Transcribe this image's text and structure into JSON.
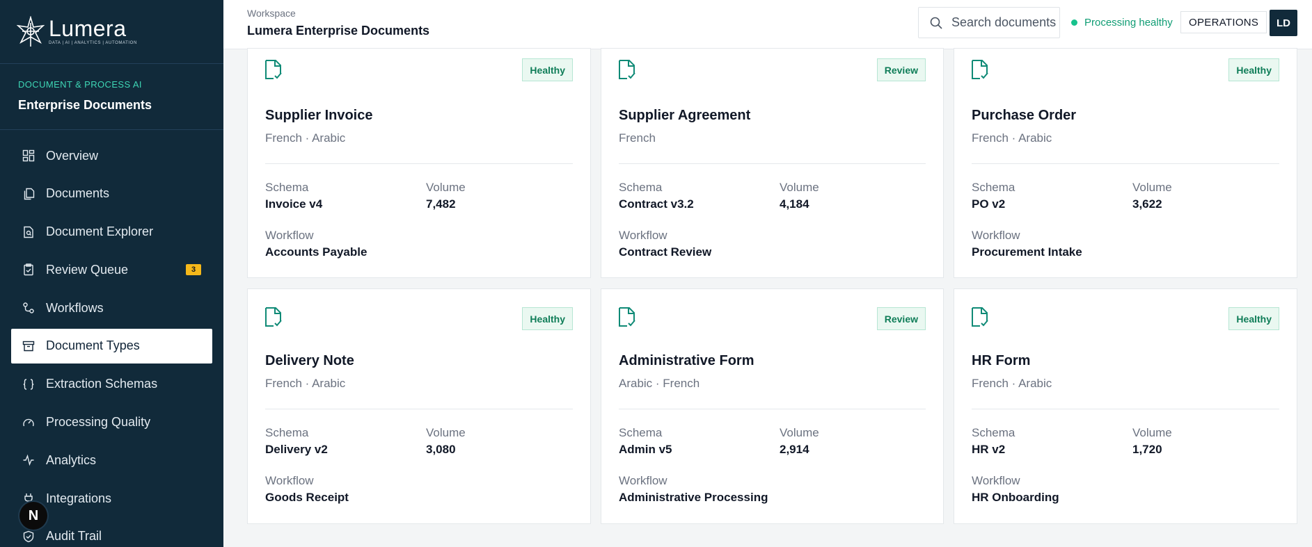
{
  "brand": {
    "name": "Lumera",
    "tagline": "DATA | AI | ANALYTICS | AUTOMATION"
  },
  "sidebar": {
    "section_kicker": "DOCUMENT & PROCESS AI",
    "section_title": "Enterprise Documents",
    "items": [
      {
        "label": "Overview",
        "icon": "grid-icon"
      },
      {
        "label": "Documents",
        "icon": "documents-icon"
      },
      {
        "label": "Document Explorer",
        "icon": "file-search-icon"
      },
      {
        "label": "Review Queue",
        "icon": "clipboard-check-icon",
        "badge": "3"
      },
      {
        "label": "Workflows",
        "icon": "workflow-icon"
      },
      {
        "label": "Document Types",
        "icon": "archive-icon",
        "active": true
      },
      {
        "label": "Extraction Schemas",
        "icon": "braces-icon"
      },
      {
        "label": "Processing Quality",
        "icon": "gauge-icon"
      },
      {
        "label": "Analytics",
        "icon": "activity-icon"
      },
      {
        "label": "Integrations",
        "icon": "plug-icon"
      },
      {
        "label": "Audit Trail",
        "icon": "shield-check-icon"
      }
    ],
    "fab_label": "N"
  },
  "header": {
    "breadcrumb": "Workspace",
    "title": "Lumera Enterprise Documents",
    "search_placeholder": "Search documents",
    "status": "Processing healthy",
    "role": "OPERATIONS",
    "avatar": "LD"
  },
  "labels": {
    "schema": "Schema",
    "volume": "Volume",
    "workflow": "Workflow"
  },
  "cards": [
    {
      "title": "Supplier Invoice",
      "langs": "French · Arabic",
      "status": "Healthy",
      "schema": "Invoice v4",
      "volume": "7,482",
      "workflow": "Accounts Payable"
    },
    {
      "title": "Supplier Agreement",
      "langs": "French",
      "status": "Review",
      "schema": "Contract v3.2",
      "volume": "4,184",
      "workflow": "Contract Review"
    },
    {
      "title": "Purchase Order",
      "langs": "French · Arabic",
      "status": "Healthy",
      "schema": "PO v2",
      "volume": "3,622",
      "workflow": "Procurement Intake"
    },
    {
      "title": "Delivery Note",
      "langs": "French · Arabic",
      "status": "Healthy",
      "schema": "Delivery v2",
      "volume": "3,080",
      "workflow": "Goods Receipt"
    },
    {
      "title": "Administrative Form",
      "langs": "Arabic · French",
      "status": "Review",
      "schema": "Admin v5",
      "volume": "2,914",
      "workflow": "Administrative Processing"
    },
    {
      "title": "HR Form",
      "langs": "French · Arabic",
      "status": "Healthy",
      "schema": "HR v2",
      "volume": "1,720",
      "workflow": "HR Onboarding"
    }
  ],
  "colors": {
    "sidebar": "#112a3a",
    "accent": "#17c28d",
    "badge_bg": "#eaf8f1",
    "badge_text": "#0f7d58",
    "queue_badge": "#f5b81a"
  }
}
